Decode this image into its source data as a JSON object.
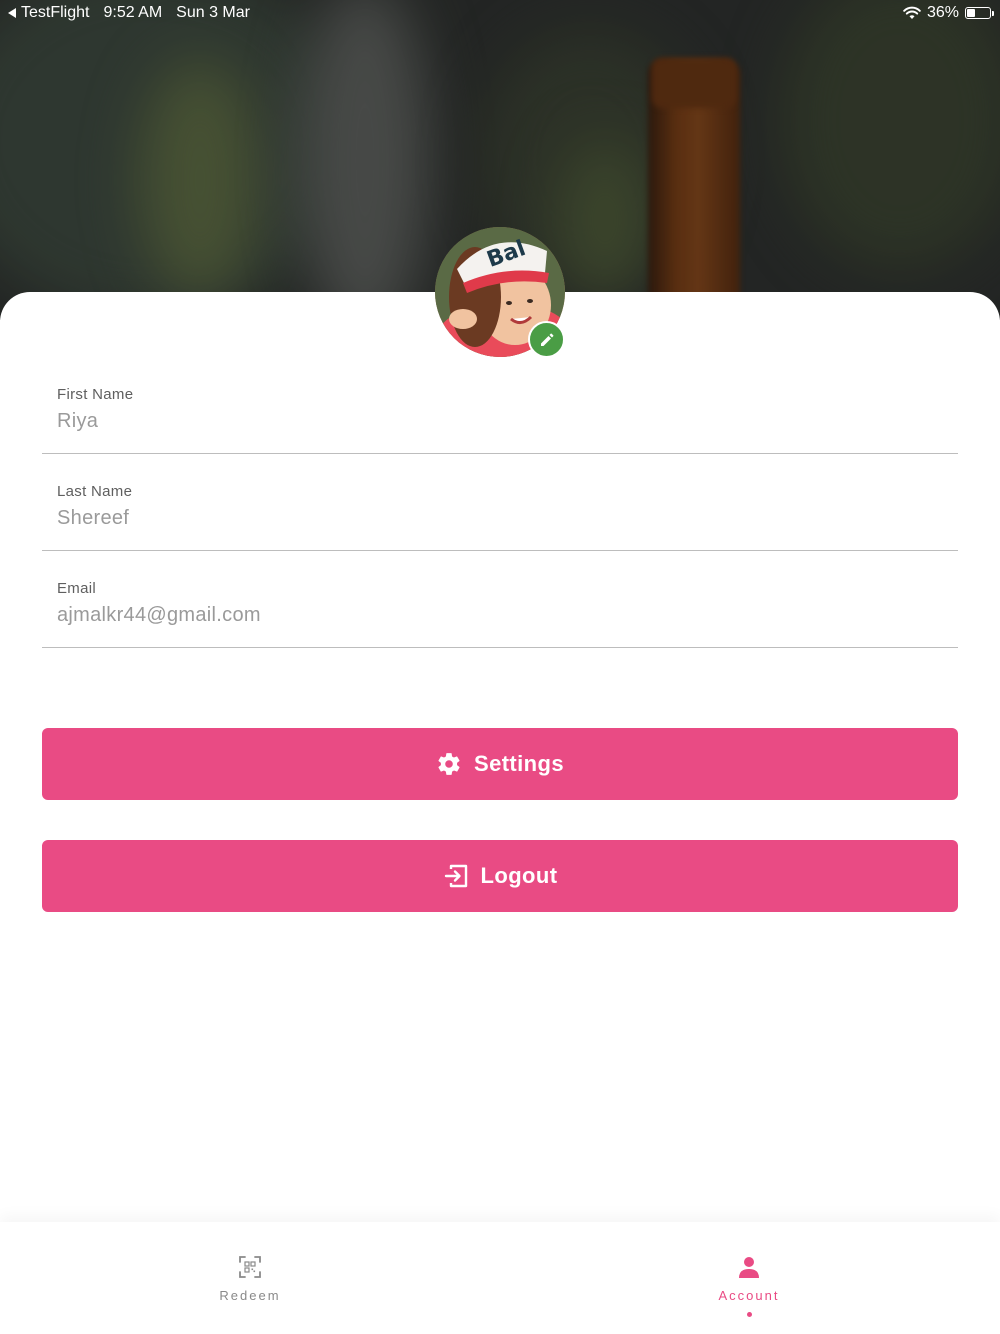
{
  "status_bar": {
    "back_app": "TestFlight",
    "time": "9:52 AM",
    "date": "Sun 3 Mar",
    "battery": "36%",
    "battery_level": 0.36
  },
  "profile": {
    "avatar_icon": "user-photo",
    "edit_icon": "pencil-icon"
  },
  "fields": {
    "first_name": {
      "label": "First Name",
      "value": "Riya"
    },
    "last_name": {
      "label": "Last Name",
      "value": "Shereef"
    },
    "email": {
      "label": "Email",
      "value": "ajmalkr44@gmail.com"
    }
  },
  "buttons": {
    "settings": {
      "label": "Settings",
      "icon": "gear-icon"
    },
    "logout": {
      "label": "Logout",
      "icon": "logout-icon"
    }
  },
  "tabbar": {
    "redeem": {
      "label": "Redeem",
      "icon": "qr-code-icon"
    },
    "account": {
      "label": "Account",
      "icon": "user-icon",
      "active": true
    }
  },
  "colors": {
    "accent": "#e94b84",
    "badge": "#4a9d45",
    "inactive_tab": "#8a8a8a"
  }
}
